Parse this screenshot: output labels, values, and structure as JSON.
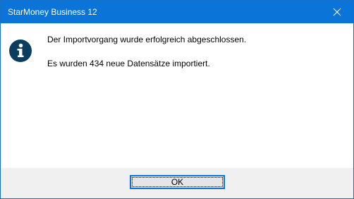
{
  "window": {
    "title": "StarMoney Business 12",
    "close_icon": "close-icon",
    "titlebar_color": "#0a74d8"
  },
  "message": {
    "icon": "info-icon",
    "icon_color": "#0b3d5e",
    "line1": "Der Importvorgang wurde erfolgreich abgeschlossen.",
    "line2": "Es wurden 434 neue Datensätze importiert."
  },
  "buttons": {
    "ok_label": "OK"
  }
}
